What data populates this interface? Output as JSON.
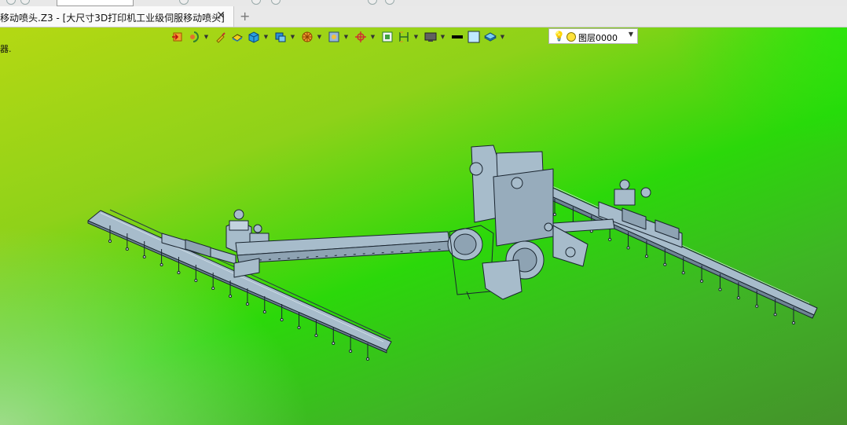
{
  "tab": {
    "title": "移动喷头.Z3 - [大尺寸3D打印机工业级伺服移动喷头]",
    "close": "✕",
    "new_tab": "+"
  },
  "viewport": {
    "status_text": "器."
  },
  "toolbar": {
    "icons": [
      "exit-icon",
      "render-icon",
      "brush-icon",
      "shaded-icon",
      "cube-icon",
      "views-icon",
      "section-icon",
      "zoom-icon",
      "orient-icon",
      "fit-icon",
      "measure-icon",
      "display-icon",
      "color-black-icon",
      "color-lightblue-icon",
      "layer-icon"
    ],
    "layer_select": {
      "value": "图层0000"
    }
  },
  "colors": {
    "part_fill": "#a7bccb",
    "part_stroke": "#1a2530",
    "layer_lamp": "#ffe23a"
  }
}
